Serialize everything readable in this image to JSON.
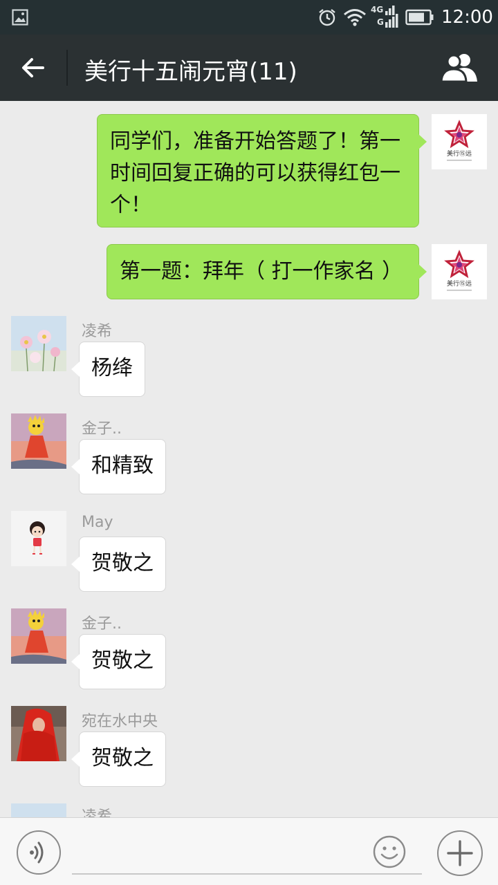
{
  "status_bar": {
    "time": "12:00",
    "network": "4G",
    "network_sub": "G"
  },
  "header": {
    "title": "美行十五闹元宵(11)"
  },
  "own_avatar_logo": "美行⑮远",
  "messages": [
    {
      "from": "me",
      "text": "同学们，准备开始答题了！第一时间回复正确的可以获得红包一个！"
    },
    {
      "from": "me",
      "text": "第一题：拜年（ 打一作家名 ）"
    },
    {
      "from": "other",
      "sender": "凌希",
      "text": "杨绛"
    },
    {
      "from": "other",
      "sender": "金子..",
      "text": "和精致"
    },
    {
      "from": "other",
      "sender": "May",
      "text": "贺敬之"
    },
    {
      "from": "other",
      "sender": "金子..",
      "text": "贺敬之"
    },
    {
      "from": "other",
      "sender": "宛在水中央",
      "text": "贺敬之"
    },
    {
      "from": "other",
      "sender": "凌希",
      "text": ""
    }
  ],
  "input": {
    "placeholder": ""
  },
  "icons": {
    "status_image": "image-icon",
    "alarm": "alarm-icon",
    "wifi": "wifi-icon",
    "signal": "signal-icon",
    "battery": "battery-icon",
    "back": "back-arrow-icon",
    "members": "group-members-icon",
    "voice": "voice-icon",
    "emoji": "emoji-icon",
    "plus": "plus-icon"
  },
  "colors": {
    "status_bar_bg": "#253033",
    "header_bg": "#2b3133",
    "chat_bg": "#ebebeb",
    "bubble_me": "#a0e75a",
    "bubble_other": "#ffffff",
    "sender_name": "#9a9a9a"
  }
}
